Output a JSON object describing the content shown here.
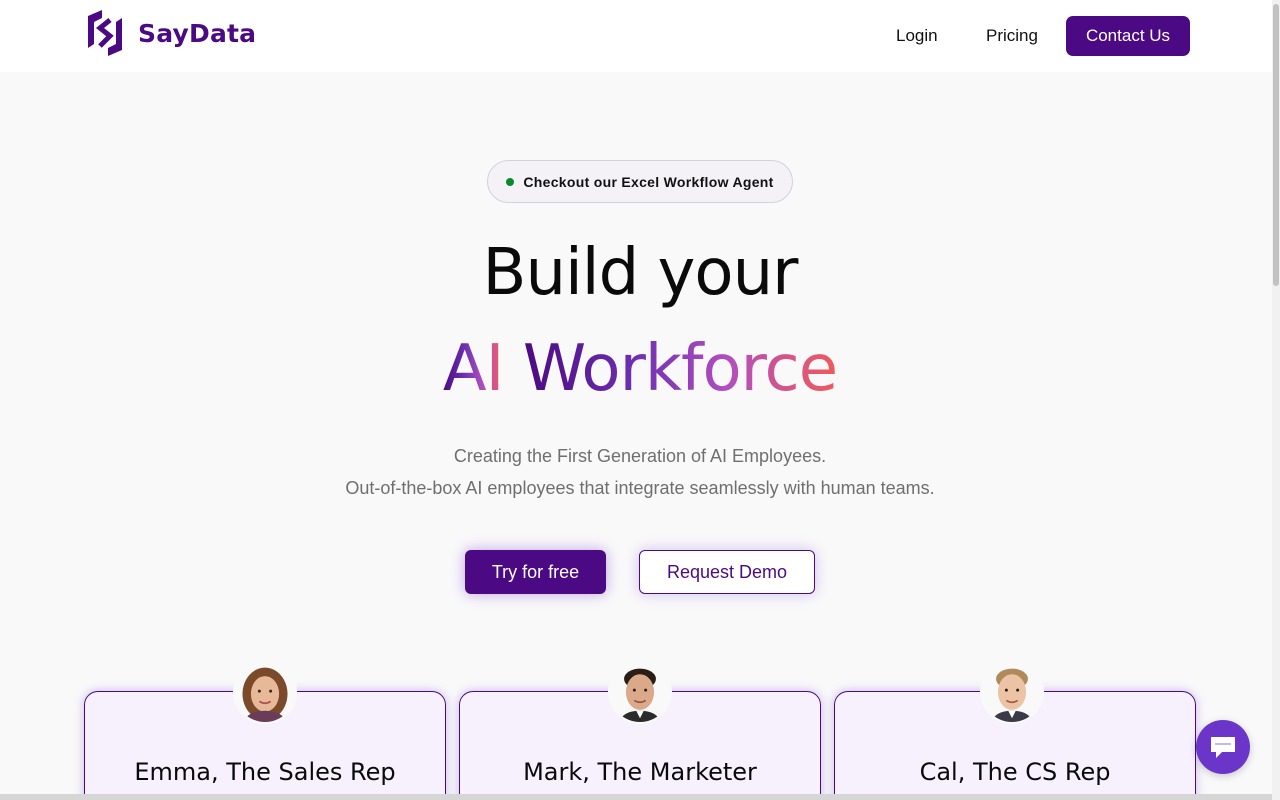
{
  "header": {
    "brand": "SayData",
    "nav": {
      "login": "Login",
      "pricing": "Pricing",
      "contact": "Contact Us"
    }
  },
  "announcement": {
    "text": "Checkout our Excel Workflow Agent",
    "dot_color": "#0b8a2b"
  },
  "hero": {
    "line1": "Build your",
    "line2_part1": "AI",
    "line2_part2": "Workforce",
    "subtitle1": "Creating the First Generation of AI Employees.",
    "subtitle2": "Out-of-the-box AI employees that integrate seamlessly with human teams.",
    "cta_primary": "Try for free",
    "cta_secondary": "Request Demo"
  },
  "employees": [
    {
      "title": "Emma, The Sales Rep",
      "avatar": "woman-avatar"
    },
    {
      "title": "Mark, The Marketer",
      "avatar": "man-avatar"
    },
    {
      "title": "Cal, The CS Rep",
      "avatar": "man-avatar"
    }
  ],
  "colors": {
    "brand": "#4b0a83",
    "gradient_start": "#4b0a83",
    "gradient_end": "#f05a5a",
    "chat": "#6c35c9"
  },
  "icons": {
    "chat": "chat-bubble-icon",
    "logo": "saydata-logo-icon"
  }
}
